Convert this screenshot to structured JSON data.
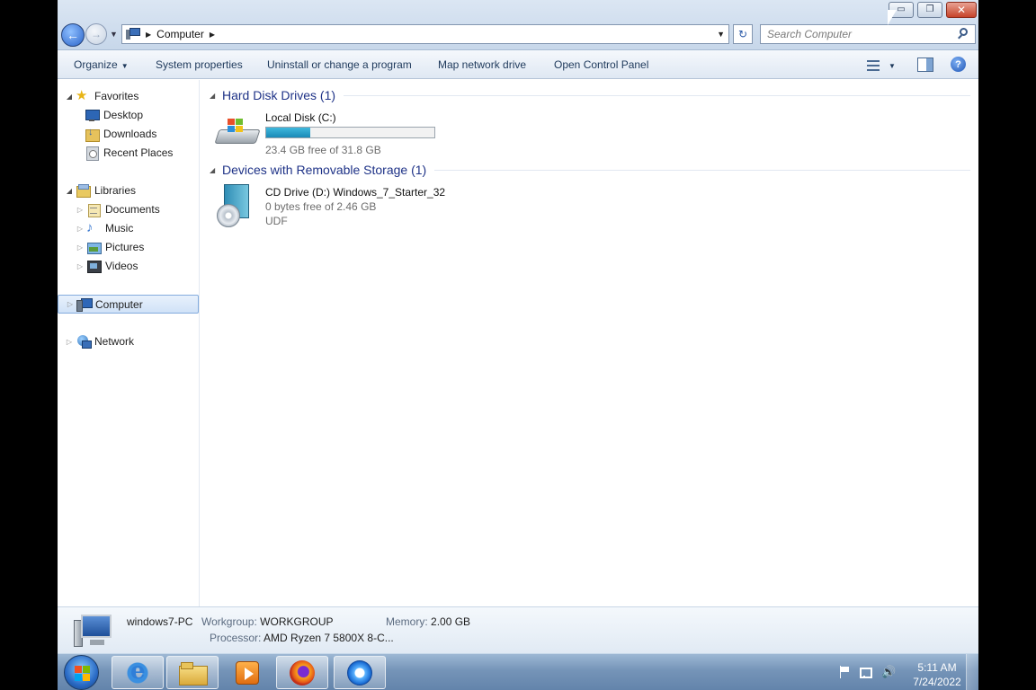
{
  "window": {
    "minimize_glyph": "▭",
    "maximize_glyph": "❐",
    "close_glyph": "✕"
  },
  "address": {
    "location": "Computer",
    "refresh_glyph": "↻"
  },
  "search": {
    "placeholder": "Search Computer"
  },
  "commands": {
    "organize": "Organize",
    "system_properties": "System properties",
    "uninstall": "Uninstall or change a program",
    "map_drive": "Map network drive",
    "control_panel": "Open Control Panel",
    "help": "?"
  },
  "nav": {
    "favorites": "Favorites",
    "desktop": "Desktop",
    "downloads": "Downloads",
    "recent_places": "Recent Places",
    "libraries": "Libraries",
    "documents": "Documents",
    "music": "Music",
    "pictures": "Pictures",
    "videos": "Videos",
    "computer": "Computer",
    "network": "Network"
  },
  "groups": {
    "hdd_title": "Hard Disk Drives (1)",
    "removable_title": "Devices with Removable Storage (1)"
  },
  "drives": {
    "c": {
      "name": "Local Disk (C:)",
      "free_text": "23.4 GB free of 31.8 GB",
      "used_fraction": 0.264
    },
    "d": {
      "name": "CD Drive (D:) Windows_7_Starter_32",
      "free_text": "0 bytes free of 2.46 GB",
      "filesystem": "UDF"
    }
  },
  "details": {
    "computer_name": "windows7-PC",
    "workgroup_label": "Workgroup:",
    "workgroup_value": "WORKGROUP",
    "memory_label": "Memory:",
    "memory_value": "2.00 GB",
    "processor_label": "Processor:",
    "processor_value": "AMD Ryzen 7 5800X 8-C..."
  },
  "taskbar": {
    "time": "5:11 AM",
    "date": "7/24/2022",
    "volume_glyph": "🔊"
  },
  "colors": {
    "accent": "#1e3287",
    "selection": "#d0e2f7",
    "usage_bar": "#26a0da"
  }
}
